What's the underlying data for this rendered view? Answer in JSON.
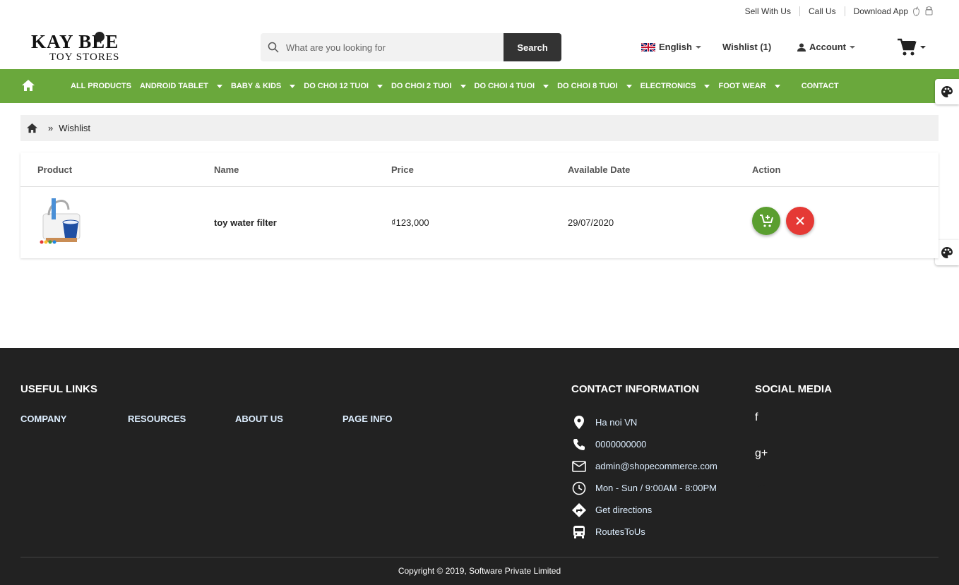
{
  "topbar": {
    "sell": "Sell With Us",
    "call": "Call Us",
    "download": "Download App"
  },
  "logo": {
    "line1": "KAY BEE",
    "line2": "TOY STORES"
  },
  "search": {
    "placeholder": "What are you looking for",
    "button": "Search"
  },
  "header": {
    "language": "English",
    "wishlist": "Wishlist (1)",
    "account": "Account"
  },
  "menu": [
    {
      "label": "ALL PRODUCTS",
      "dropdown": false
    },
    {
      "label": "ANDROID TABLET",
      "dropdown": true
    },
    {
      "label": "BABY & KIDS",
      "dropdown": true
    },
    {
      "label": "DO CHOI 12 TUOI",
      "dropdown": true
    },
    {
      "label": "DO CHOI 2 TUOI",
      "dropdown": true
    },
    {
      "label": "DO CHOI 4 TUOI",
      "dropdown": true
    },
    {
      "label": "DO CHOI 8 TUOI",
      "dropdown": true
    },
    {
      "label": "ELECTRONICS",
      "dropdown": true
    },
    {
      "label": "FOOT WEAR",
      "dropdown": true
    },
    {
      "label": "CONTACT",
      "dropdown": false
    }
  ],
  "breadcrumb": {
    "sep": "»",
    "current": "Wishlist"
  },
  "table": {
    "headers": [
      "Product",
      "Name",
      "Price",
      "Available Date",
      "Action"
    ],
    "rows": [
      {
        "name": "toy water filter",
        "price": "₫123,000",
        "date": "29/07/2020"
      }
    ]
  },
  "footer": {
    "useful_title": "USEFUL LINKS",
    "links": [
      "COMPANY",
      "RESOURCES",
      "ABOUT US",
      "PAGE INFO"
    ],
    "contact_title": "CONTACT INFORMATION",
    "contact": [
      {
        "icon": "location-pin-icon",
        "text": "Ha noi VN"
      },
      {
        "icon": "phone-icon",
        "text": "0000000000"
      },
      {
        "icon": "mail-icon",
        "text": "admin@shopecommerce.com"
      },
      {
        "icon": "clock-icon",
        "text": "Mon - Sun / 9:00AM - 8:00PM"
      },
      {
        "icon": "directions-icon",
        "text": "Get directions"
      },
      {
        "icon": "bus-icon",
        "text": "RoutesToUs"
      }
    ],
    "social_title": "SOCIAL MEDIA",
    "social": [
      "facebook-icon",
      "google-plus-icon",
      "twitter-icon"
    ],
    "copyright": "Copyright © 2019, Software Private Limited"
  },
  "colors": {
    "menu_green": "#6aa83c",
    "footer_bg": "#222222",
    "add_cart_green": "#5a9e2f",
    "remove_red": "#e53935"
  }
}
